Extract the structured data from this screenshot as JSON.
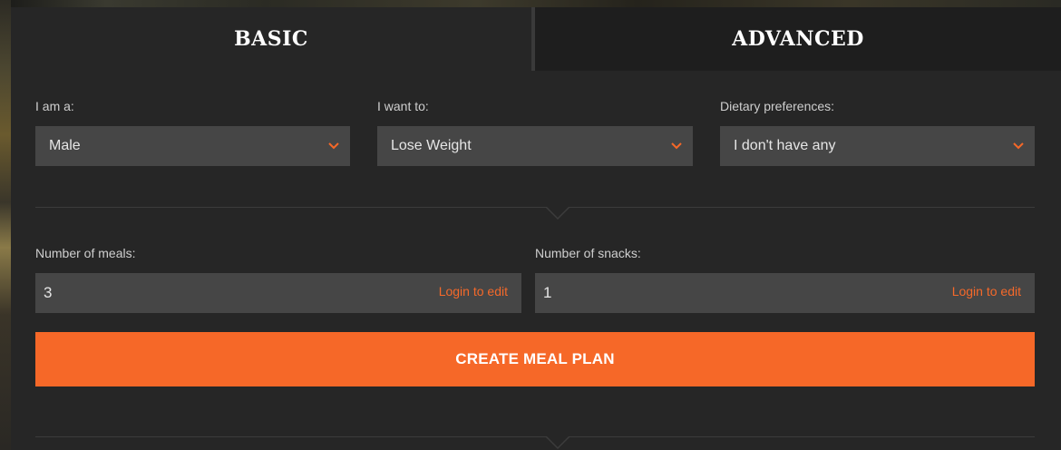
{
  "tabs": [
    {
      "label": "BASIC"
    },
    {
      "label": "ADVANCED"
    }
  ],
  "basic": {
    "gender": {
      "label": "I am a:",
      "value": "Male",
      "icon": "chevron-down-icon"
    },
    "goal": {
      "label": "I want to:",
      "value": "Lose Weight",
      "icon": "chevron-down-icon"
    },
    "diet": {
      "label": "Dietary preferences:",
      "value": "I don't have any",
      "icon": "chevron-down-icon"
    },
    "meals": {
      "label": "Number of meals:",
      "value": "3",
      "login_link": "Login to edit"
    },
    "snacks": {
      "label": "Number of snacks:",
      "value": "1",
      "login_link": "Login to edit"
    },
    "create_button": "CREATE MEAL PLAN"
  },
  "colors": {
    "accent": "#f66828",
    "panel": "#262626",
    "field": "#464646"
  }
}
